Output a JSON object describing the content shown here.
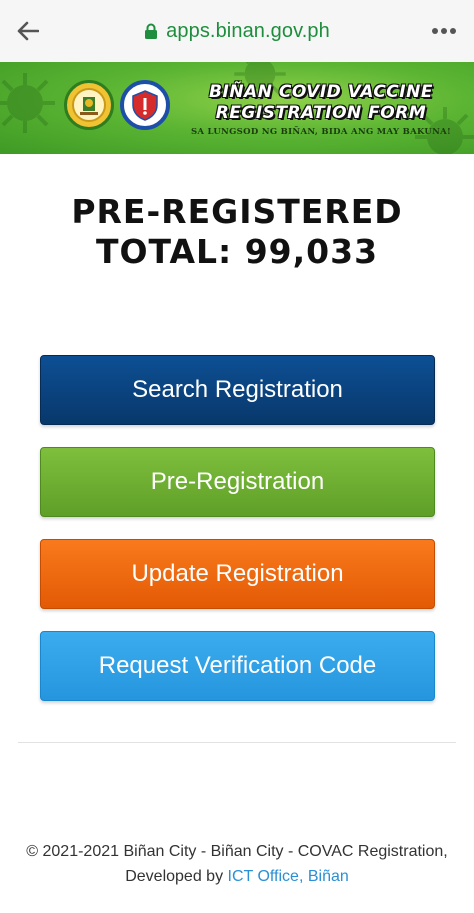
{
  "browser": {
    "url": "apps.binan.gov.ph"
  },
  "banner": {
    "title_line1": "BIÑAN COVID VACCINE",
    "title_line2": "REGISTRATION FORM",
    "tagline": "SA LUNGSOD NG BIÑAN, BIDA ANG MAY BAKUNA!"
  },
  "summary": {
    "label": "PRE-REGISTERED",
    "total": "TOTAL: 99,033"
  },
  "actions": {
    "search": "Search Registration",
    "pre_registration": "Pre-Registration",
    "update": "Update Registration",
    "verify": "Request Verification Code"
  },
  "footer": {
    "line1": "© 2021-2021 Biñan City - Biñan City - COVAC Registration,",
    "developed_by": "Developed by",
    "link": "ICT Office, Biñan"
  },
  "colors": {
    "url_green": "#1e8e3e",
    "search_blue": "#0a4784",
    "pre_green": "#6eb034",
    "update_orange": "#f06a10",
    "verify_blue": "#33a4ea",
    "link_blue": "#2a8fd4"
  }
}
